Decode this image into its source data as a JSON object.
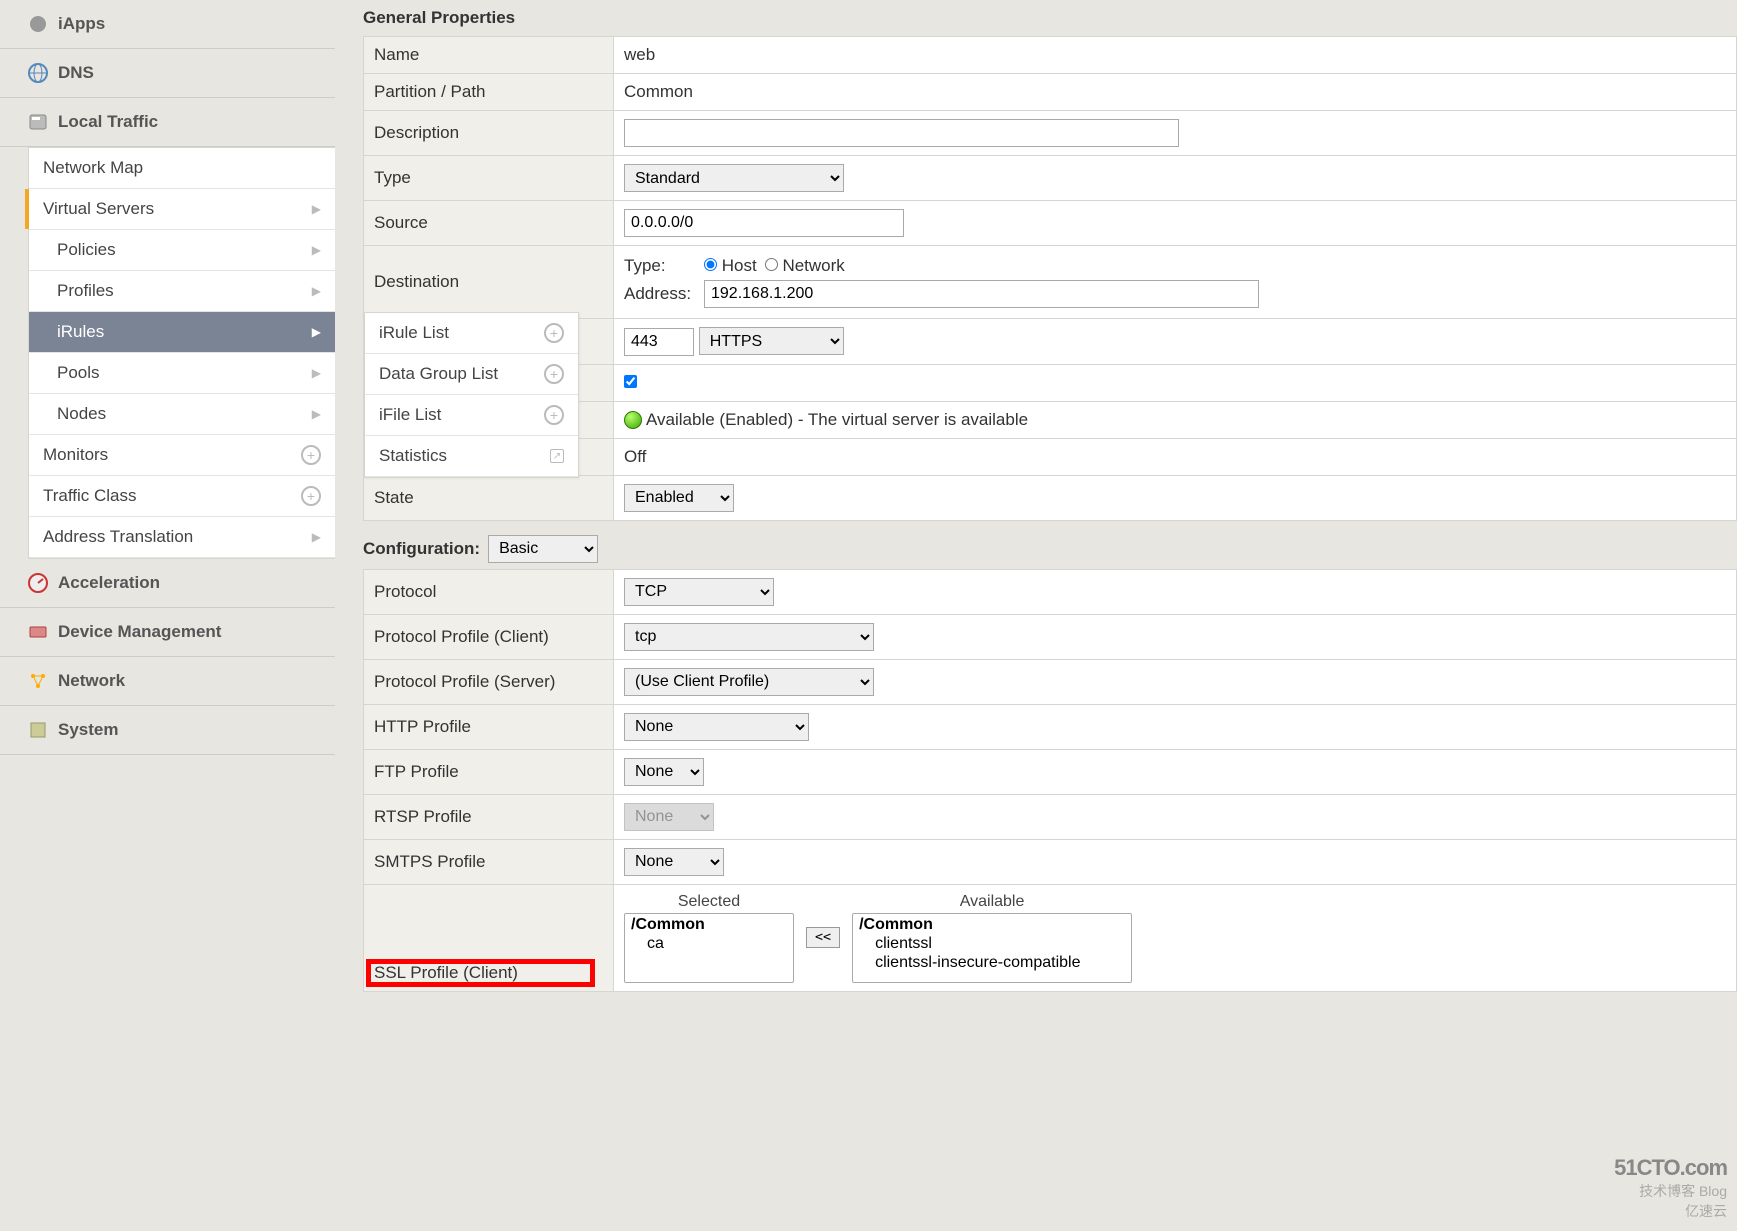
{
  "sidebar": {
    "sections": {
      "iapps": "iApps",
      "dns": "DNS",
      "local_traffic": "Local Traffic",
      "acceleration": "Acceleration",
      "device_mgmt": "Device Management",
      "network": "Network",
      "system": "System"
    },
    "lt_items": {
      "network_map": "Network Map",
      "virtual_servers": "Virtual Servers",
      "policies": "Policies",
      "profiles": "Profiles",
      "irules": "iRules",
      "pools": "Pools",
      "nodes": "Nodes",
      "monitors": "Monitors",
      "traffic_class": "Traffic Class",
      "address_translation": "Address Translation"
    },
    "flyout": {
      "irule_list": "iRule List",
      "data_group_list": "Data Group List",
      "ifile_list": "iFile List",
      "statistics": "Statistics"
    }
  },
  "general": {
    "title": "General Properties",
    "rows": {
      "name_label": "Name",
      "name_value": "web",
      "partition_label": "Partition / Path",
      "partition_value": "Common",
      "description_label": "Description",
      "description_value": "",
      "type_label": "Type",
      "type_value": "Standard",
      "source_label": "Source",
      "source_value": "0.0.0.0/0",
      "destination_label": "Destination",
      "dest_type_label": "Type:",
      "dest_host": "Host",
      "dest_network": "Network",
      "dest_addr_label": "Address:",
      "dest_addr_value": "192.168.1.200",
      "service_port_value": "443",
      "service_proto_value": "HTTPS",
      "status_text": "Available (Enabled) - The virtual server is available",
      "off_text": "Off",
      "state_label": "State",
      "state_value": "Enabled"
    }
  },
  "config": {
    "title": "Configuration:",
    "mode": "Basic",
    "rows": {
      "protocol_label": "Protocol",
      "protocol_value": "TCP",
      "pprof_client_label": "Protocol Profile (Client)",
      "pprof_client_value": "tcp",
      "pprof_server_label": "Protocol Profile (Server)",
      "pprof_server_value": "(Use Client Profile)",
      "http_label": "HTTP Profile",
      "http_value": "None",
      "ftp_label": "FTP Profile",
      "ftp_value": "None",
      "rtsp_label": "RTSP Profile",
      "rtsp_value": "None",
      "smtps_label": "SMTPS Profile",
      "smtps_value": "None",
      "ssl_client_label": "SSL Profile (Client)"
    },
    "ssl_client": {
      "selected_title": "Selected",
      "selected_header": "/Common",
      "selected_items": [
        "ca"
      ],
      "available_title": "Available",
      "available_header": "/Common",
      "available_items": [
        "clientssl",
        "clientssl-insecure-compatible"
      ],
      "move_left": "<<"
    }
  },
  "watermark": {
    "logo": "51CTO.com",
    "sub1": "技术博客  Blog",
    "sub2": "亿速云"
  }
}
